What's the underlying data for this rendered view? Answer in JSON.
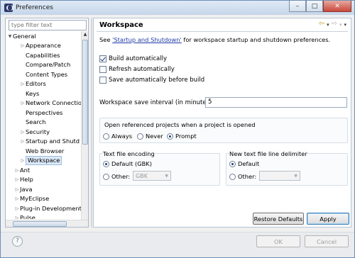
{
  "window": {
    "title": "Preferences",
    "controls": [
      "–",
      "□",
      "✕"
    ]
  },
  "sidebar": {
    "filter_placeholder": "type filter text",
    "items": [
      {
        "label": "General",
        "expand": "▼"
      },
      {
        "label": "Appearance",
        "expand": "▷"
      },
      {
        "label": "Capabilities",
        "expand": ""
      },
      {
        "label": "Compare/Patch",
        "expand": ""
      },
      {
        "label": "Content Types",
        "expand": ""
      },
      {
        "label": "Editors",
        "expand": "▷"
      },
      {
        "label": "Keys",
        "expand": ""
      },
      {
        "label": "Network Connectio",
        "expand": "▷"
      },
      {
        "label": "Perspectives",
        "expand": ""
      },
      {
        "label": "Search",
        "expand": ""
      },
      {
        "label": "Security",
        "expand": "▷"
      },
      {
        "label": "Startup and Shutd",
        "expand": "▷"
      },
      {
        "label": "Web Browser",
        "expand": ""
      },
      {
        "label": "Workspace",
        "expand": "▷"
      },
      {
        "label": "Ant",
        "expand": "▷"
      },
      {
        "label": "Help",
        "expand": "▷"
      },
      {
        "label": "Java",
        "expand": "▷"
      },
      {
        "label": "MyEclipse",
        "expand": "▷"
      },
      {
        "label": "Plug-in Development",
        "expand": "▷"
      },
      {
        "label": "Pulse",
        "expand": "▷"
      }
    ],
    "selected": "Workspace"
  },
  "page": {
    "title": "Workspace",
    "desc_prefix": "See ",
    "desc_link": "'Startup and Shutdown'",
    "desc_suffix": " for workspace startup and shutdown preferences.",
    "checkboxes": [
      {
        "label": "Build automatically",
        "checked": true
      },
      {
        "label": "Refresh automatically",
        "checked": false
      },
      {
        "label": "Save automatically before build",
        "checked": false
      }
    ],
    "interval_label": "Workspace save interval (in minutes):",
    "interval_value": "5",
    "open_group": {
      "title": "Open referenced projects when a project is opened",
      "options": [
        "Always",
        "Never",
        "Prompt"
      ],
      "selected": "Prompt"
    },
    "encoding_group": {
      "title": "Text file encoding",
      "default_label": "Default (GBK)",
      "other_label": "Other:",
      "other_value": "GBK",
      "selected": "Default"
    },
    "delimiter_group": {
      "title": "New text file line delimiter",
      "default_label": "Default",
      "other_label": "Other:",
      "selected": "Default"
    },
    "restore_label": "Restore Defaults",
    "apply_label": "Apply"
  },
  "footer": {
    "ok_label": "OK",
    "cancel_label": "Cancel",
    "help": "?"
  }
}
